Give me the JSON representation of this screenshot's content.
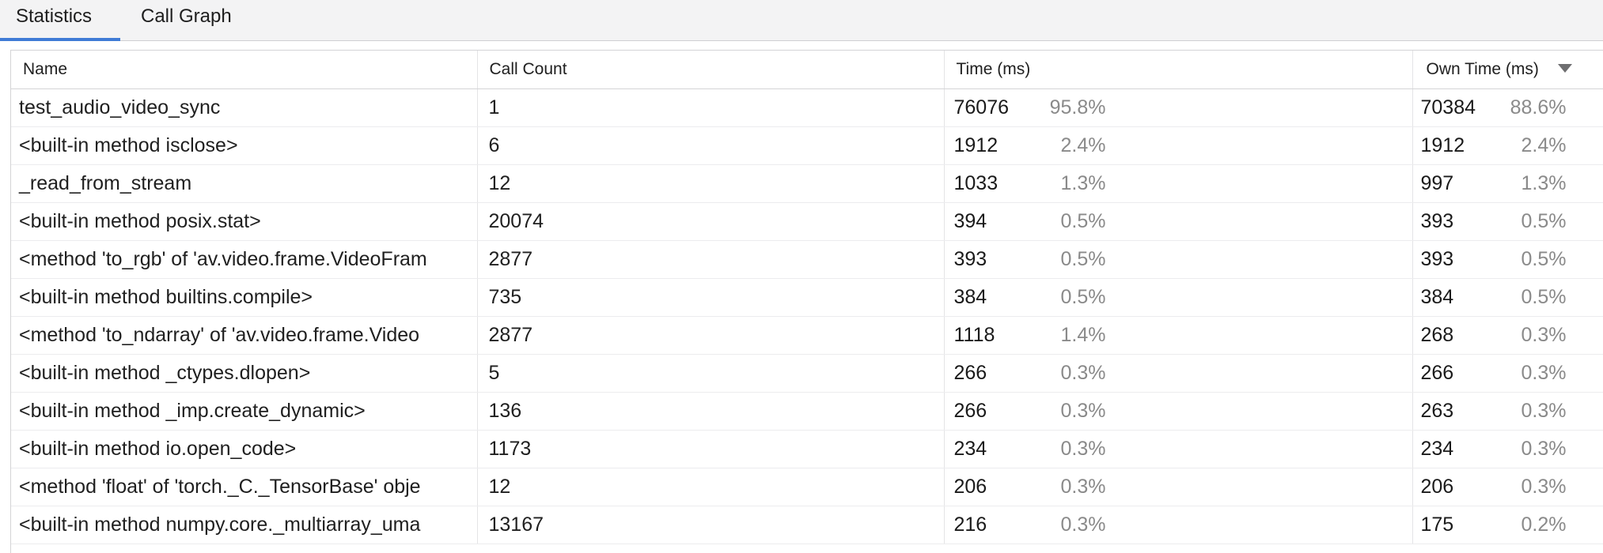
{
  "tabs": [
    {
      "label": "Statistics",
      "active": true
    },
    {
      "label": "Call Graph",
      "active": false
    }
  ],
  "columns": {
    "name": "Name",
    "call_count": "Call Count",
    "time": "Time (ms)",
    "own_time": "Own Time (ms)"
  },
  "sort": {
    "column": "own_time",
    "direction": "descending"
  },
  "rows": [
    {
      "name": "test_audio_video_sync",
      "count": "1",
      "time": "76076",
      "time_pct": "95.8%",
      "own": "70384",
      "own_pct": "88.6%"
    },
    {
      "name": "<built-in method isclose>",
      "count": "6",
      "time": "1912",
      "time_pct": "2.4%",
      "own": "1912",
      "own_pct": "2.4%"
    },
    {
      "name": "_read_from_stream",
      "count": "12",
      "time": "1033",
      "time_pct": "1.3%",
      "own": "997",
      "own_pct": "1.3%"
    },
    {
      "name": "<built-in method posix.stat>",
      "count": "20074",
      "time": "394",
      "time_pct": "0.5%",
      "own": "393",
      "own_pct": "0.5%"
    },
    {
      "name": "<method 'to_rgb' of 'av.video.frame.VideoFram",
      "count": "2877",
      "time": "393",
      "time_pct": "0.5%",
      "own": "393",
      "own_pct": "0.5%"
    },
    {
      "name": "<built-in method builtins.compile>",
      "count": "735",
      "time": "384",
      "time_pct": "0.5%",
      "own": "384",
      "own_pct": "0.5%"
    },
    {
      "name": "<method 'to_ndarray' of 'av.video.frame.Video",
      "count": "2877",
      "time": "1118",
      "time_pct": "1.4%",
      "own": "268",
      "own_pct": "0.3%"
    },
    {
      "name": "<built-in method _ctypes.dlopen>",
      "count": "5",
      "time": "266",
      "time_pct": "0.3%",
      "own": "266",
      "own_pct": "0.3%"
    },
    {
      "name": "<built-in method _imp.create_dynamic>",
      "count": "136",
      "time": "266",
      "time_pct": "0.3%",
      "own": "263",
      "own_pct": "0.3%"
    },
    {
      "name": "<built-in method io.open_code>",
      "count": "1173",
      "time": "234",
      "time_pct": "0.3%",
      "own": "234",
      "own_pct": "0.3%"
    },
    {
      "name": "<method 'float' of 'torch._C._TensorBase' obje",
      "count": "12",
      "time": "206",
      "time_pct": "0.3%",
      "own": "206",
      "own_pct": "0.3%"
    },
    {
      "name": "<built-in method numpy.core._multiarray_uma",
      "count": "13167",
      "time": "216",
      "time_pct": "0.3%",
      "own": "175",
      "own_pct": "0.2%"
    }
  ]
}
